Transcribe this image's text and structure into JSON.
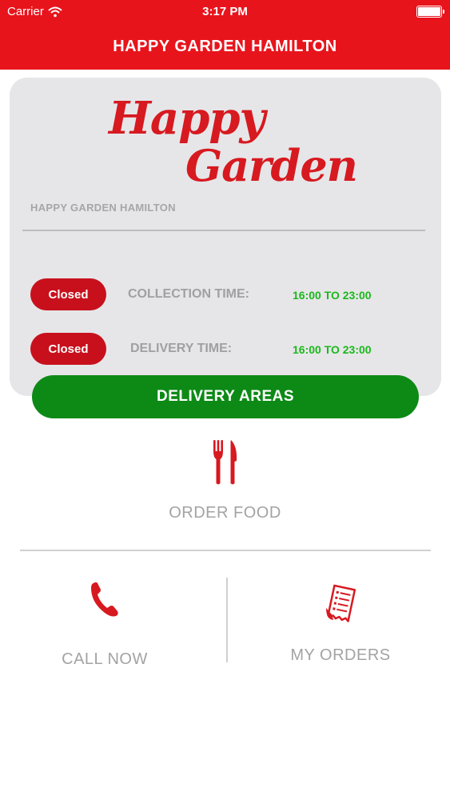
{
  "status_bar": {
    "carrier": "Carrier",
    "time": "3:17 PM"
  },
  "nav": {
    "title": "HAPPY GARDEN HAMILTON"
  },
  "card": {
    "logo_line1": "Happy",
    "logo_line2": "Garden",
    "restaurant_name": "HAPPY GARDEN HAMILTON",
    "collection": {
      "status": "Closed",
      "label": "COLLECTION TIME:",
      "hours": "16:00 TO 23:00"
    },
    "delivery": {
      "status": "Closed",
      "label": "DELIVERY TIME:",
      "hours": "16:00 TO 23:00"
    }
  },
  "delivery_areas_button": "DELIVERY AREAS",
  "actions": {
    "order_food": {
      "label": "ORDER FOOD",
      "icon": "fork-knife-icon"
    },
    "call_now": {
      "label": "CALL NOW",
      "icon": "phone-icon"
    },
    "my_orders": {
      "label": "MY ORDERS",
      "icon": "receipt-icon"
    }
  },
  "colors": {
    "brand_red": "#e8141c",
    "closed_red": "#c8101c",
    "open_green": "#1bb81b",
    "button_green": "#0d8a16",
    "muted_gray": "#a3a3a5"
  }
}
